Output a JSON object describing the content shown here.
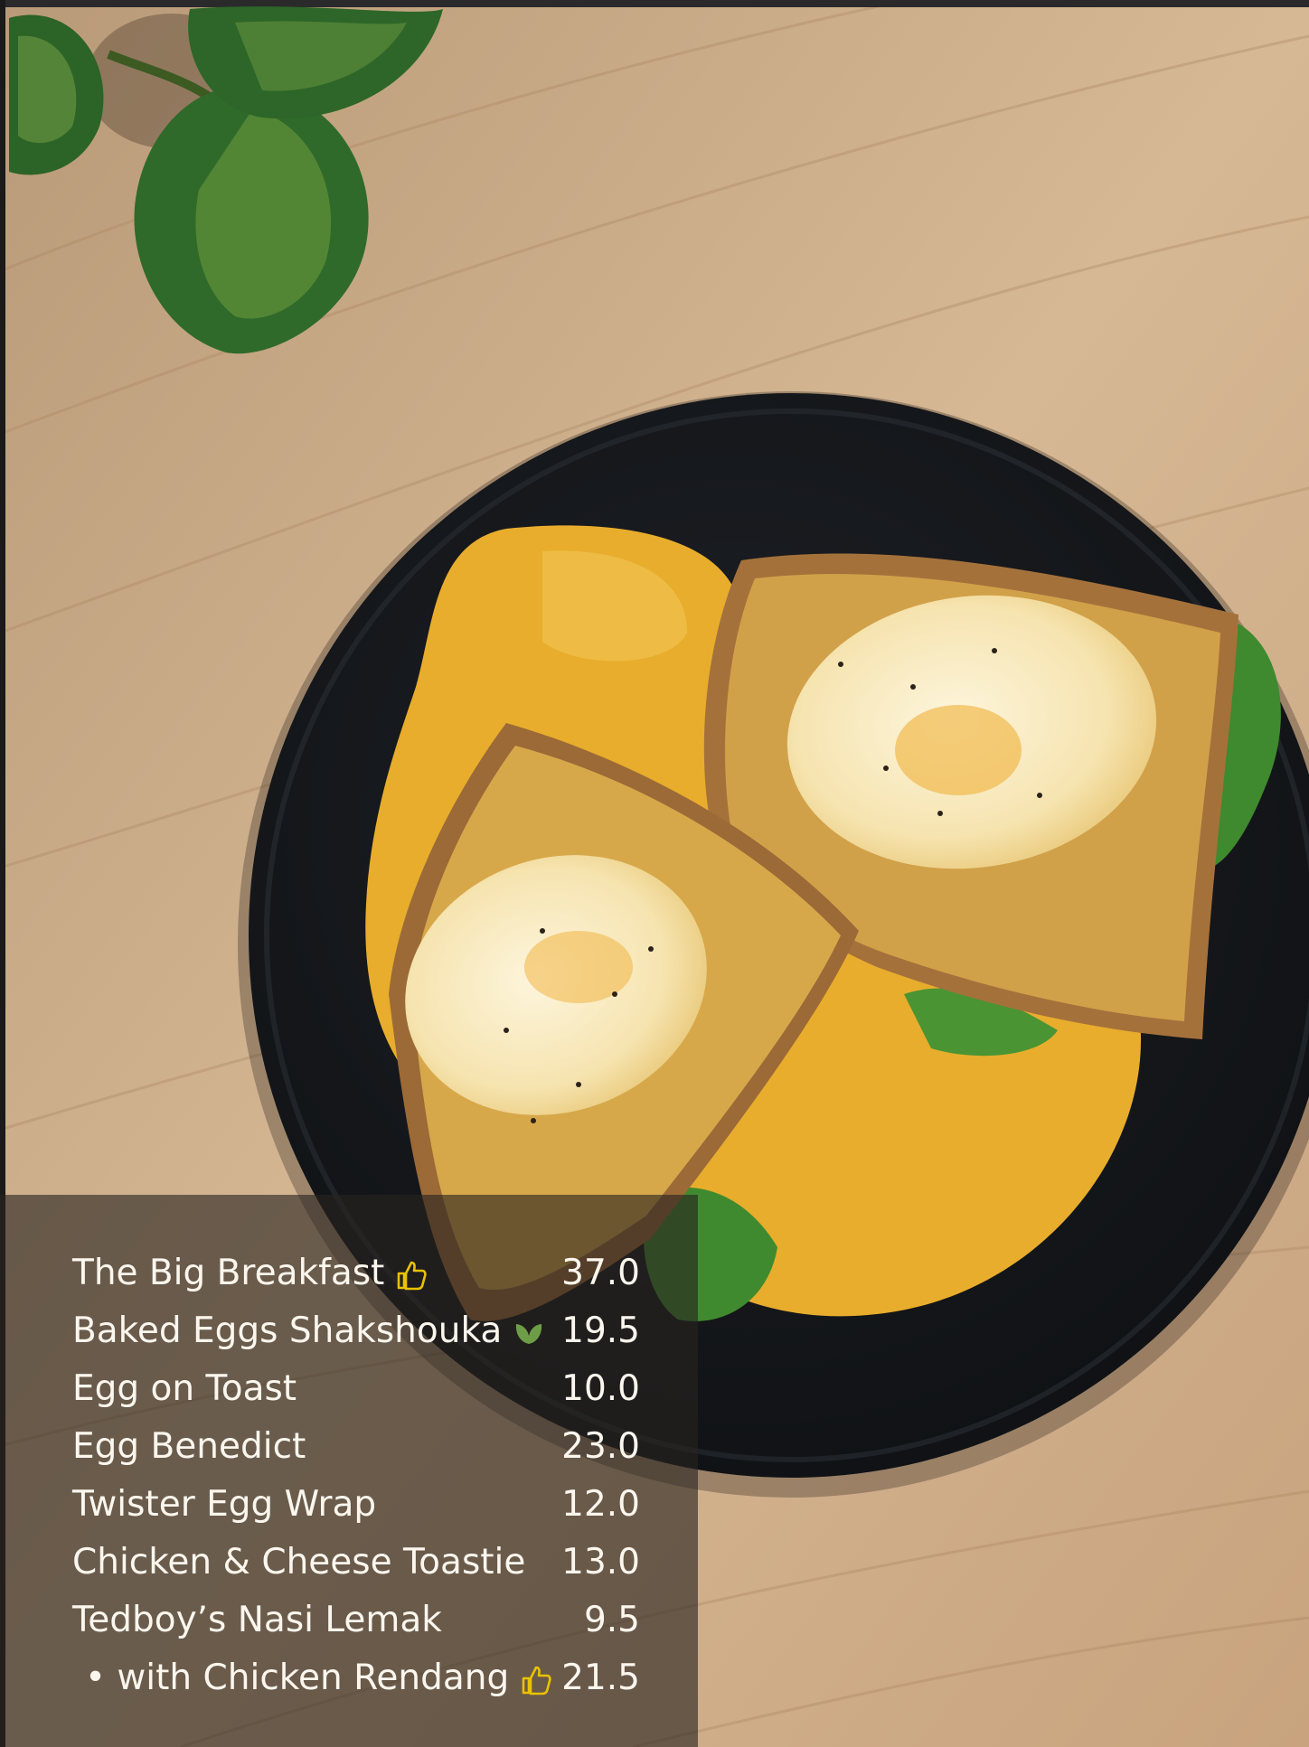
{
  "colors": {
    "table_wood": "#c9a985",
    "plate": "#16181b",
    "hollandaise": "#e8ad2c",
    "toast": "#caa45a",
    "egg_white": "#fbf1d2",
    "leaf": "#2f6a2a",
    "menu_text": "#fbf6ee",
    "thumbs_up_icon": "#e9c200",
    "leaf_icon": "#6e9d47"
  },
  "menu": {
    "items": [
      {
        "name": "The Big Breakfast",
        "price": "37.0",
        "icon": "thumbs-up-icon"
      },
      {
        "name": "Baked Eggs Shakshouka",
        "price": "19.5",
        "icon": "leaf-icon"
      },
      {
        "name": "Egg on Toast",
        "price": "10.0"
      },
      {
        "name": "Egg Benedict",
        "price": "23.0"
      },
      {
        "name": "Twister Egg Wrap",
        "price": "12.0"
      },
      {
        "name": "Chicken & Cheese Toastie",
        "price": "13.0"
      },
      {
        "name": "Tedboy’s Nasi Lemak",
        "price": "9.5"
      },
      {
        "name": "• with Chicken Rendang",
        "price": "21.5",
        "icon": "thumbs-up-icon"
      }
    ]
  }
}
